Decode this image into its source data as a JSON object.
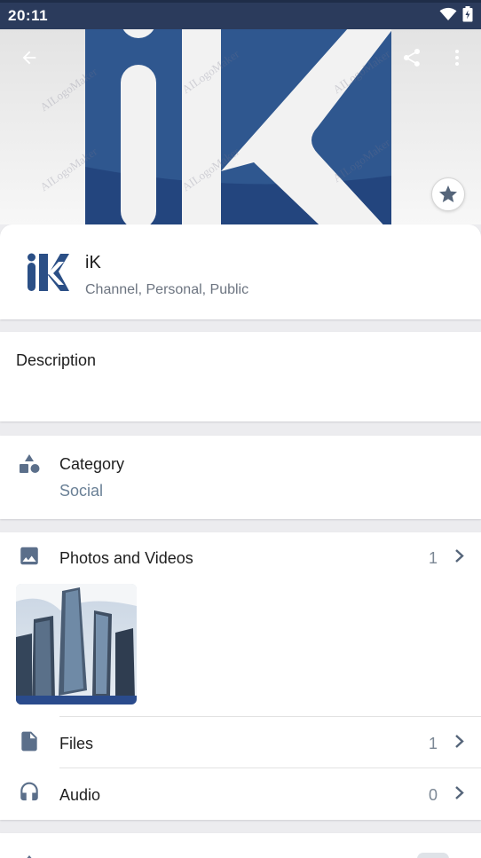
{
  "status_bar": {
    "time": "20:11"
  },
  "header": {
    "watermark": "AILogoMaker"
  },
  "channel": {
    "avatar_text": "iK",
    "name": "iK",
    "meta": "Channel, Personal, Public"
  },
  "description": {
    "label": "Description"
  },
  "category": {
    "label": "Category",
    "value": "Social"
  },
  "media": {
    "photos": {
      "label": "Photos and Videos",
      "count": "1"
    },
    "files": {
      "label": "Files",
      "count": "1"
    },
    "audio": {
      "label": "Audio",
      "count": "0"
    }
  },
  "colors": {
    "brand": "#2b4f86",
    "status_bar": "#2b3b5c",
    "accent": "#6a8096"
  },
  "icons": [
    "back-arrow-icon",
    "share-icon",
    "more-vert-icon",
    "star-icon",
    "shapes-icon",
    "image-icon",
    "file-icon",
    "headphones-icon",
    "chevron-right-icon",
    "wifi-icon",
    "battery-icon"
  ]
}
